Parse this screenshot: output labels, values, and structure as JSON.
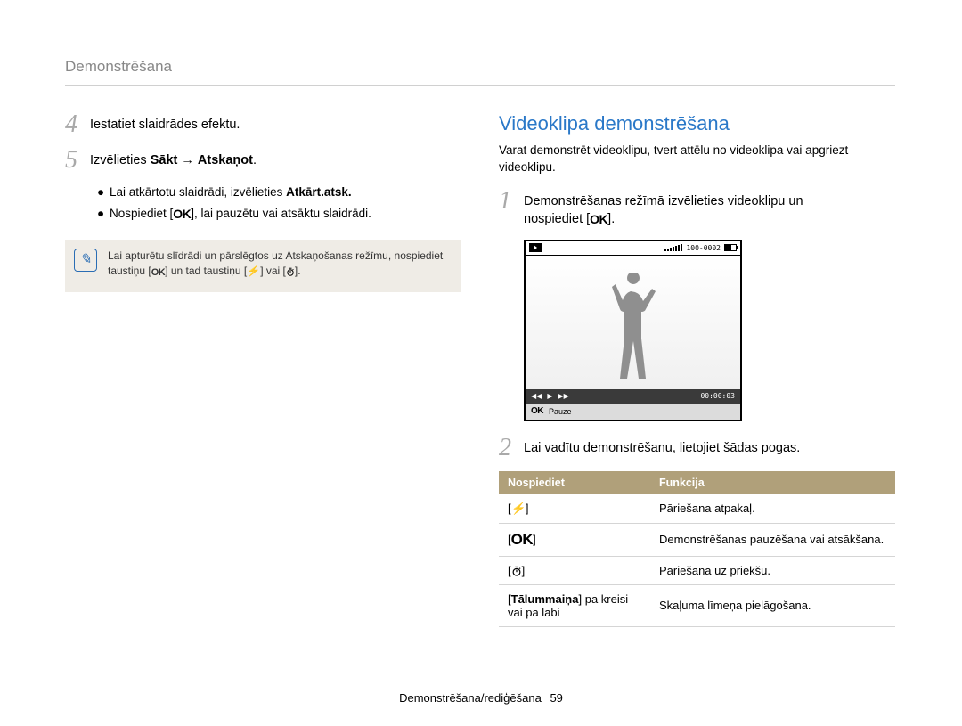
{
  "header": {
    "title": "Demonstrēšana"
  },
  "left": {
    "step4": {
      "n": "4",
      "text": "Iestatiet slaidrādes efektu."
    },
    "step5": {
      "n": "5",
      "prefix": "Izvēlieties ",
      "bold1": "Sākt",
      "arrow": " → ",
      "bold2": "Atskaņot",
      "suffix": "."
    },
    "sub1_prefix": "Lai atkārtotu slaidrādi, izvēlieties ",
    "sub1_bold": "Atkārt.atsk.",
    "sub2_prefix": "Nospiediet [",
    "sub2_suffix": "], lai pauzētu vai atsāktu slaidrādi.",
    "note_l1": "Lai apturētu slīdrādi un pārslēgtos uz Atskaņošanas režīmu, nospiediet",
    "note_l2a": "taustiņu [",
    "note_l2b": "] un tad taustiņu [",
    "note_l2c": "] vai [",
    "note_l2d": "]."
  },
  "right": {
    "title": "Videoklipa demonstrēšana",
    "intro": "Varat demonstrēt videoklipu, tvert attēlu no videoklipa vai apgriezt videoklipu.",
    "step1": {
      "n": "1",
      "l1": "Demonstrēšanas režīmā izvēlieties videoklipu un",
      "l2a": "nospiediet [",
      "l2b": "]."
    },
    "video": {
      "counter": "100-0002",
      "time": "00:00:03",
      "pause_hint": "Pauze",
      "ok": "OK"
    },
    "step2": {
      "n": "2",
      "text": "Lai vadītu demonstrēšanu, lietojiet šādas pogas."
    },
    "table": {
      "h1": "Nospiediet",
      "h2": "Funkcija",
      "rows": [
        {
          "key_type": "flash",
          "func": "Pāriešana atpakaļ."
        },
        {
          "key_type": "ok",
          "func": "Demonstrēšanas pauzēšana vai atsākšana."
        },
        {
          "key_type": "timer",
          "func": "Pāriešana uz priekšu."
        },
        {
          "key_type": "zoom",
          "key_text_a": "[",
          "key_bold": "Tālummaiņa",
          "key_text_b": "] pa kreisi vai pa labi",
          "func": "Skaļuma līmeņa pielāgošana."
        }
      ]
    }
  },
  "footer": {
    "text": "Demonstrēšana/rediģēšana",
    "page": "59"
  }
}
